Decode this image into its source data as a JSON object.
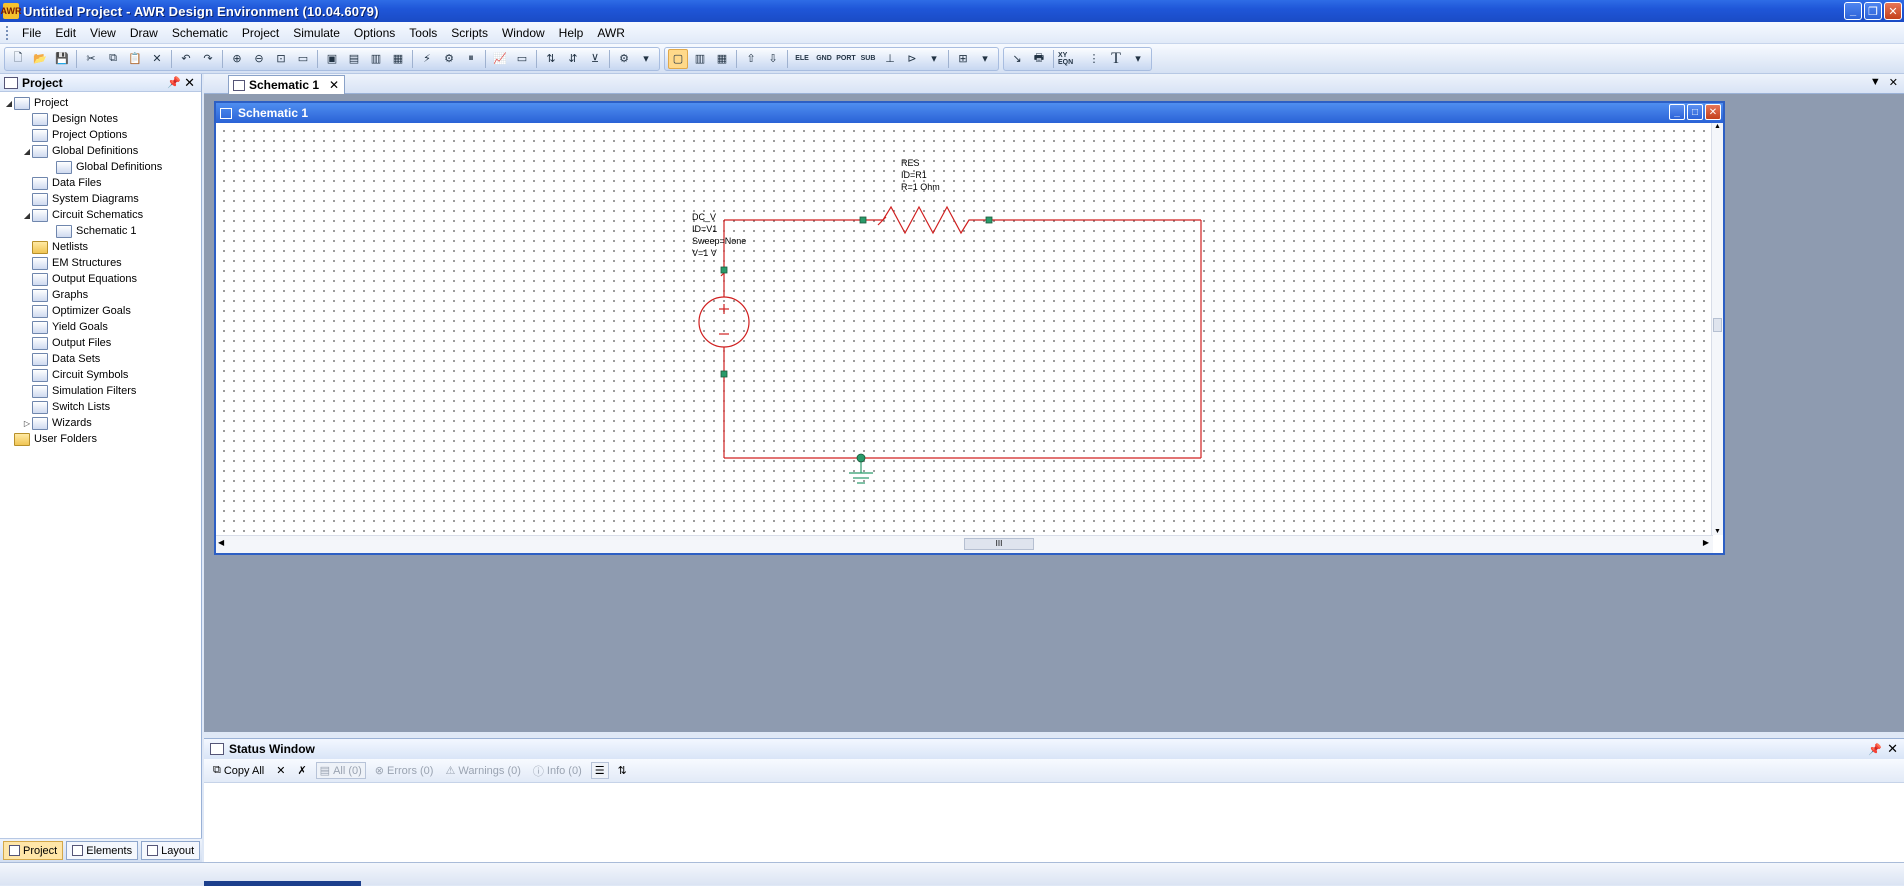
{
  "window": {
    "title": "Untitled Project - AWR Design Environment (10.04.6079)",
    "app_icon": "AWR"
  },
  "menu": [
    "File",
    "Edit",
    "View",
    "Draw",
    "Schematic",
    "Project",
    "Simulate",
    "Options",
    "Tools",
    "Scripts",
    "Window",
    "Help",
    "AWR"
  ],
  "toolbar_labels": {
    "ele": "ELE",
    "gnd": "GND",
    "port": "PORT",
    "sub": "SUB",
    "xy_eqn": "XY EQN",
    "text": "T"
  },
  "project_panel": {
    "title": "Project",
    "tree": {
      "root": "Project",
      "design_notes": "Design Notes",
      "project_options": "Project Options",
      "global_definitions": "Global Definitions",
      "global_definitions_child": "Global Definitions",
      "data_files": "Data Files",
      "system_diagrams": "System Diagrams",
      "circuit_schematics": "Circuit Schematics",
      "schematic_1": "Schematic 1",
      "netlists": "Netlists",
      "em_structures": "EM Structures",
      "output_equations": "Output Equations",
      "graphs": "Graphs",
      "optimizer_goals": "Optimizer Goals",
      "yield_goals": "Yield Goals",
      "output_files": "Output Files",
      "data_sets": "Data Sets",
      "circuit_symbols": "Circuit Symbols",
      "simulation_filters": "Simulation Filters",
      "switch_lists": "Switch Lists",
      "wizards": "Wizards",
      "user_folders": "User Folders"
    },
    "tabs": {
      "project": "Project",
      "elements": "Elements",
      "layout": "Layout"
    }
  },
  "doc_tab": {
    "label": "Schematic 1"
  },
  "schematic_window": {
    "title": "Schematic 1",
    "resistor": {
      "name": "RES",
      "id": "ID=R1",
      "value": "R=1 Ohm"
    },
    "source": {
      "name": "DC_V",
      "id": "ID=V1",
      "sweep": "Sweep=None",
      "value": "V=1 V"
    },
    "scroll_thumb": "III",
    "wire_color": "#d02020",
    "node_color": "#2a9a6a"
  },
  "status_window": {
    "title": "Status Window",
    "copy_all": "Copy All",
    "all": "All (0)",
    "errors": "Errors (0)",
    "warnings": "Warnings (0)",
    "info": "Info (0)"
  }
}
